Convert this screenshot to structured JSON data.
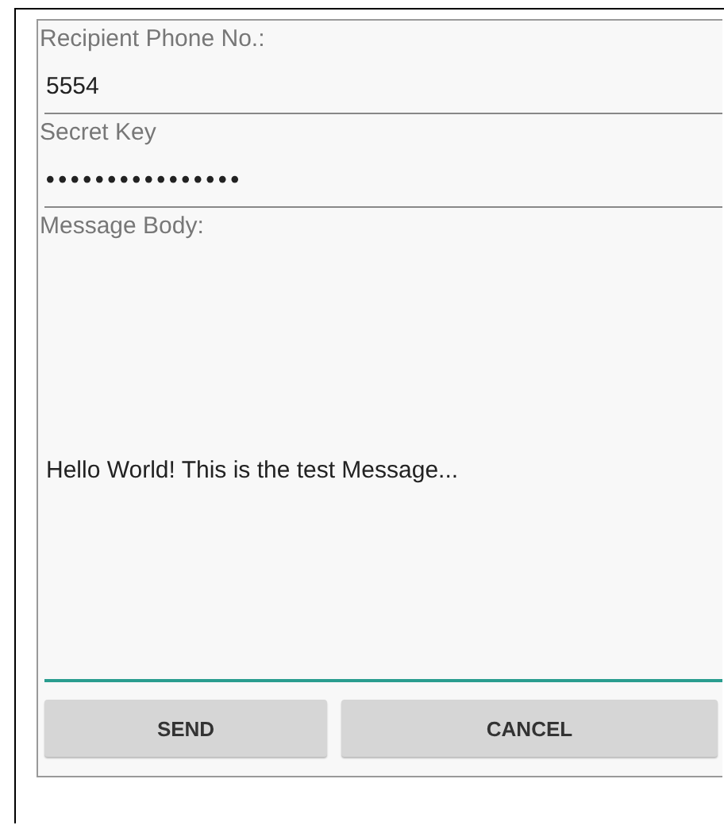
{
  "fields": [
    {
      "kind": "single",
      "label": "Recipient Phone No.:",
      "value": "5554",
      "focused": false
    },
    {
      "kind": "single",
      "label": "Secret Key",
      "value": "••••••••••••••••",
      "focused": false
    },
    {
      "kind": "multiline",
      "label": "Message Body:",
      "value": "Hello World! This is the test Message...",
      "focused": true
    }
  ],
  "buttons": [
    {
      "label": "SEND"
    },
    {
      "label": "CANCEL"
    }
  ]
}
